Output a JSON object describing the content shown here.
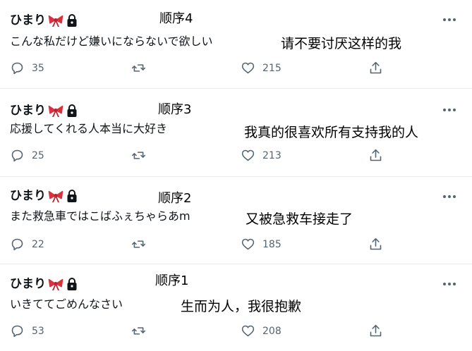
{
  "tweets": [
    {
      "author": "ひまり",
      "order": "顺序4",
      "text": "こんな私だけど嫌いにならないで欲しい",
      "translation": "请不要讨厌这样的我",
      "replies": "35",
      "likes": "215"
    },
    {
      "author": "ひまり",
      "order": "顺序3",
      "text": "応援してくれる人本当に大好き",
      "translation": "我真的很喜欢所有支持我的人",
      "replies": "25",
      "likes": "213"
    },
    {
      "author": "ひまり",
      "order": "顺序2",
      "text": "また救急車ではこばふぇちゃらあm",
      "translation": "又被急救车接走了",
      "replies": "22",
      "likes": "185"
    },
    {
      "author": "ひまり",
      "order": "顺序1",
      "text": "いきててごめんなさい",
      "translation": "生而为人，我很抱歉",
      "replies": "53",
      "likes": "208"
    }
  ],
  "icons": {
    "author_badges": [
      "ribbon-emoji",
      "lock-icon"
    ],
    "more": "more-horizontal-icon",
    "actions": [
      "reply-icon",
      "retweet-icon",
      "like-icon",
      "share-icon"
    ]
  },
  "colors": {
    "text": "#0f1419",
    "secondary": "#536471",
    "divider": "#e7e9ea",
    "ribbon": "#d9323f"
  }
}
